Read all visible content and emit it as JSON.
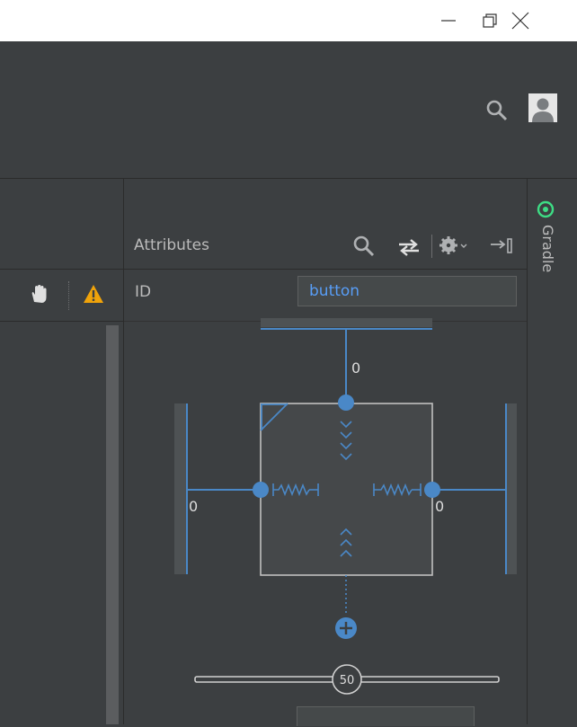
{
  "window": {
    "minimize_icon": "minimize-icon",
    "restore_icon": "restore-icon",
    "close_icon": "close-icon"
  },
  "toolbar": {
    "search_icon": "search-icon",
    "avatar_icon": "user-avatar-icon"
  },
  "left_panel": {
    "pan_icon": "hand-icon",
    "warning_icon": "warning-icon"
  },
  "attributes_panel": {
    "title": "Attributes",
    "id_label": "ID",
    "id_value": "button",
    "constraints": {
      "top_margin": "0",
      "left_margin": "0",
      "right_margin": "0"
    },
    "bias_slider": {
      "value": "50",
      "level": 0.5
    }
  },
  "right_strip": {
    "gradle_label": "Gradle"
  },
  "colors": {
    "background": "#3c3f41",
    "accent": "#4a88c7",
    "input_text": "#589df6",
    "warning": "#f0a30a",
    "gradle_green": "#3ddc84"
  }
}
